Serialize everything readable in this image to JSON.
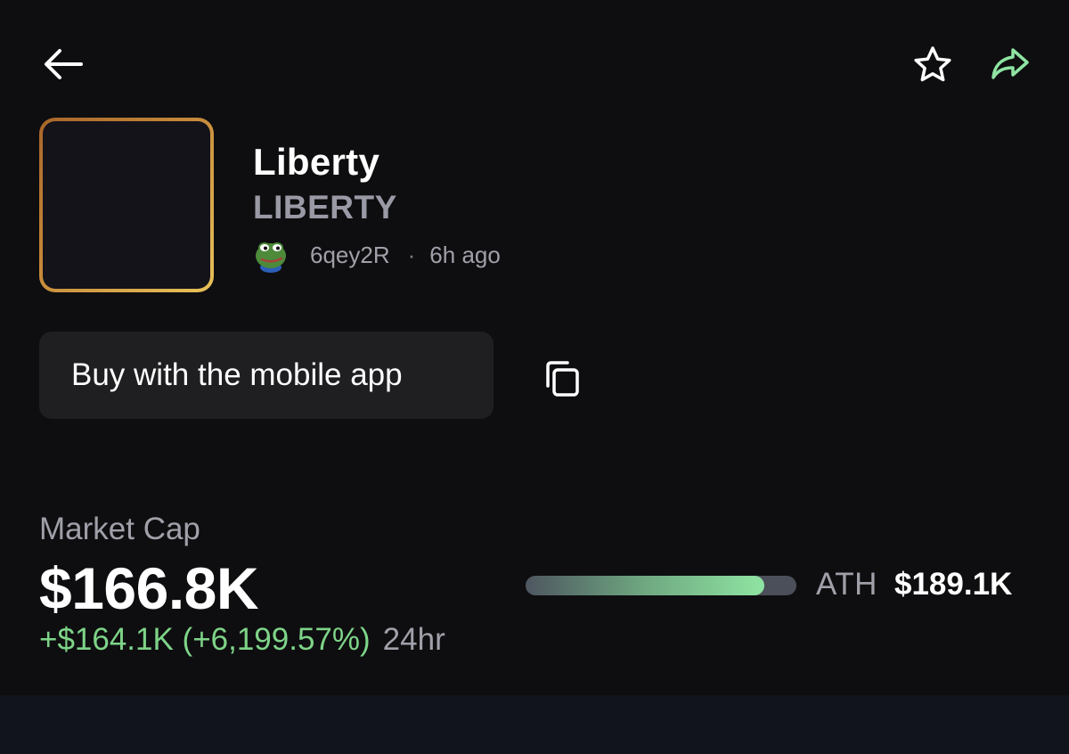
{
  "header": {
    "back_icon": "arrow-left-icon",
    "favorite_icon": "star-outline-icon",
    "share_icon": "share-arrow-icon"
  },
  "token": {
    "name": "Liberty",
    "ticker": "LIBERTY",
    "creator": "6qey2R",
    "separator": "·",
    "created_ago": "6h ago"
  },
  "actions": {
    "buy_label": "Buy with the mobile app",
    "copy_icon": "copy-icon"
  },
  "market": {
    "label": "Market Cap",
    "value": "$166.8K",
    "change": "+$164.1K (+6,199.57%)",
    "period": "24hr",
    "ath_label": "ATH",
    "ath_value": "$189.1K",
    "ath_progress": 0.88
  },
  "colors": {
    "background": "#0e0e10",
    "accent_green": "#7ed488",
    "muted_text": "#a0a0aa",
    "button_bg": "#1f1f22"
  }
}
